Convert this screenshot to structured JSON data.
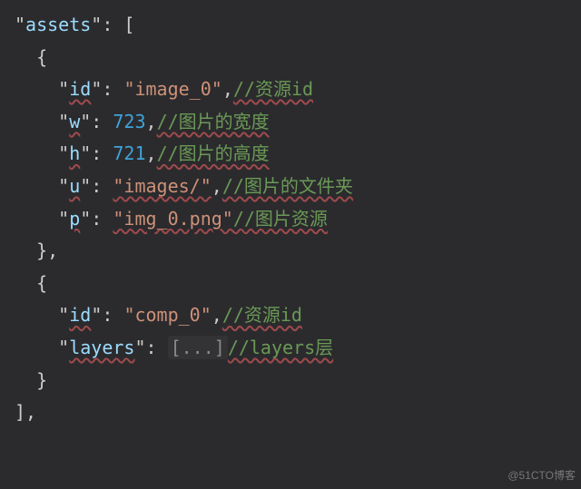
{
  "root": {
    "key": "assets",
    "quote": "\"",
    "colon": ":",
    "bracket_open": "[",
    "bracket_close": "],"
  },
  "obj": {
    "brace_open": "{",
    "brace_close_comma": "},",
    "brace_close": "}"
  },
  "items": [
    {
      "id": {
        "quote_open": "\"",
        "key": "id",
        "colon": "\": ",
        "val_q": "\"image_0\"",
        "comma": ",",
        "comment": "//资源id"
      },
      "w": {
        "quote_open": "\"",
        "key": "w",
        "colon": "\": ",
        "val": "723",
        "comma": ",",
        "comment": "//图片的宽度"
      },
      "h": {
        "quote_open": "\"",
        "key": "h",
        "colon": "\": ",
        "val": "721",
        "comma": ",",
        "comment": "//图片的高度"
      },
      "u": {
        "quote_open": "\"",
        "key": "u",
        "colon": "\": ",
        "val_q": "\"images/\"",
        "comma": ",",
        "comment": "//图片的文件夹"
      },
      "p": {
        "quote_open": "\"",
        "key": "p",
        "colon": "\": ",
        "val_q": "\"img_0.png\"",
        "comma": "",
        "comment": "//图片资源"
      }
    },
    {
      "id": {
        "quote_open": "\"",
        "key": "id",
        "colon": "\": ",
        "val_q": "\"comp_0\"",
        "comma": ",",
        "comment": "//资源id"
      },
      "layers": {
        "quote_open": "\"",
        "key": "layers",
        "colon": "\": ",
        "folded": "[...]",
        "comment": "//layers层"
      }
    }
  ],
  "watermark": "@51CTO博客"
}
